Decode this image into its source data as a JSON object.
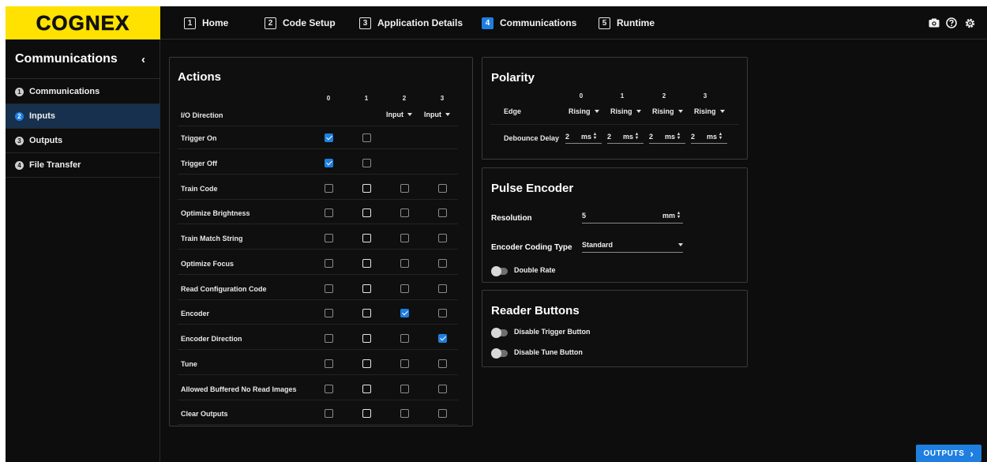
{
  "brand": {
    "logo": "COGNEX",
    "color": "#ffe200"
  },
  "nav": {
    "tabs": [
      {
        "num": "1",
        "label": "Home",
        "active": false
      },
      {
        "num": "2",
        "label": "Code Setup",
        "active": false
      },
      {
        "num": "3",
        "label": "Application Details",
        "active": false
      },
      {
        "num": "4",
        "label": "Communications",
        "active": true
      },
      {
        "num": "5",
        "label": "Runtime",
        "active": false
      }
    ],
    "icons": [
      "camera-icon",
      "help-icon",
      "settings-icon"
    ]
  },
  "sidebar": {
    "title": "Communications",
    "collapse": "‹",
    "items": [
      {
        "num": "1",
        "label": "Communications",
        "active": false
      },
      {
        "num": "2",
        "label": "Inputs",
        "active": true
      },
      {
        "num": "3",
        "label": "Outputs",
        "active": false
      },
      {
        "num": "4",
        "label": "File Transfer",
        "active": false
      }
    ]
  },
  "actions": {
    "title": "Actions",
    "columns": [
      "0",
      "1",
      "2",
      "3"
    ],
    "io_direction": {
      "label": "I/O Direction",
      "values": [
        "",
        "",
        "Input",
        "Input"
      ]
    },
    "rows": [
      {
        "label": "Trigger On",
        "cells": [
          1,
          0,
          null,
          null
        ]
      },
      {
        "label": "Trigger Off",
        "cells": [
          1,
          0,
          null,
          null
        ]
      },
      {
        "label": "Train Code",
        "cells": [
          0,
          0,
          0,
          0
        ]
      },
      {
        "label": "Optimize Brightness",
        "cells": [
          0,
          0,
          0,
          0
        ]
      },
      {
        "label": "Train Match String",
        "cells": [
          0,
          0,
          0,
          0
        ]
      },
      {
        "label": "Optimize Focus",
        "cells": [
          0,
          0,
          0,
          0
        ]
      },
      {
        "label": "Read Configuration Code",
        "cells": [
          0,
          0,
          0,
          0
        ]
      },
      {
        "label": "Encoder",
        "cells": [
          0,
          0,
          1,
          0
        ]
      },
      {
        "label": "Encoder Direction",
        "cells": [
          0,
          0,
          0,
          1
        ]
      },
      {
        "label": "Tune",
        "cells": [
          0,
          0,
          0,
          0
        ]
      },
      {
        "label": "Allowed Buffered No Read Images",
        "cells": [
          0,
          0,
          0,
          0
        ]
      },
      {
        "label": "Clear Outputs",
        "cells": [
          0,
          0,
          0,
          0
        ]
      }
    ]
  },
  "polarity": {
    "title": "Polarity",
    "columns": [
      "0",
      "1",
      "2",
      "3"
    ],
    "edge_label": "Edge",
    "edge_values": [
      "Rising",
      "Rising",
      "Rising",
      "Rising"
    ],
    "debounce_label": "Debounce Delay",
    "debounce_values": [
      "2",
      "2",
      "2",
      "2"
    ],
    "debounce_unit": "ms"
  },
  "pulse_encoder": {
    "title": "Pulse Encoder",
    "resolution_label": "Resolution",
    "resolution_value": "5",
    "resolution_unit": "mm",
    "coding_label": "Encoder Coding Type",
    "coding_value": "Standard",
    "double_rate_label": "Double Rate"
  },
  "reader_buttons": {
    "title": "Reader Buttons",
    "disable_trigger_label": "Disable Trigger Button",
    "disable_tune_label": "Disable Tune Button"
  },
  "footer": {
    "outputs_label": "OUTPUTS",
    "outputs_arrow": "›"
  },
  "colors": {
    "accent": "#1f7fe0",
    "background": "#0d0d0d"
  }
}
